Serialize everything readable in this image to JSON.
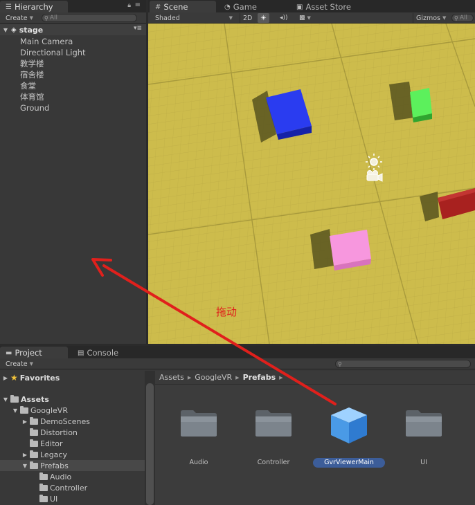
{
  "hierarchy": {
    "tab_label": "Hierarchy",
    "create_label": "Create",
    "search_placeholder": "All",
    "root_label": "stage",
    "items": [
      {
        "label": "Main Camera"
      },
      {
        "label": "Directional Light"
      },
      {
        "label": "教学楼"
      },
      {
        "label": "宿舍楼"
      },
      {
        "label": "食堂"
      },
      {
        "label": "体育馆"
      },
      {
        "label": "Ground"
      }
    ]
  },
  "scene": {
    "tabs": [
      {
        "label": "Scene",
        "icon": "grid-icon"
      },
      {
        "label": "Game",
        "icon": "pacman-icon"
      },
      {
        "label": "Asset Store",
        "icon": "bag-icon"
      }
    ],
    "shading_mode": "Shaded",
    "mode_2d_label": "2D",
    "gizmos_label": "Gizmos",
    "search_placeholder": "All",
    "ground_color": "#cdbc4c",
    "objects": [
      {
        "name": "blue-cube",
        "color": "#1f2fe0"
      },
      {
        "name": "green-cube",
        "color": "#3fd23f"
      },
      {
        "name": "red-block",
        "color": "#a4201f"
      },
      {
        "name": "pink-block",
        "color": "#f58fd6"
      }
    ]
  },
  "project": {
    "tabs": [
      {
        "label": "Project",
        "icon": "folder-icon"
      },
      {
        "label": "Console",
        "icon": "console-icon"
      }
    ],
    "create_label": "Create",
    "tree": [
      {
        "label": "Favorites",
        "level": 0,
        "bold": true,
        "expanded": false
      },
      {
        "label": "Assets",
        "level": 0,
        "bold": true,
        "expanded": true
      },
      {
        "label": "GoogleVR",
        "level": 1,
        "bold": false,
        "expanded": true
      },
      {
        "label": "DemoScenes",
        "level": 2,
        "bold": false,
        "expanded": false
      },
      {
        "label": "Distortion",
        "level": 2,
        "bold": false,
        "expanded": null
      },
      {
        "label": "Editor",
        "level": 2,
        "bold": false,
        "expanded": null
      },
      {
        "label": "Legacy",
        "level": 2,
        "bold": false,
        "expanded": false
      },
      {
        "label": "Prefabs",
        "level": 2,
        "bold": false,
        "expanded": true
      },
      {
        "label": "Audio",
        "level": 3,
        "bold": false,
        "expanded": null
      },
      {
        "label": "Controller",
        "level": 3,
        "bold": false,
        "expanded": null
      },
      {
        "label": "UI",
        "level": 3,
        "bold": false,
        "expanded": null
      }
    ],
    "breadcrumb": [
      "Assets",
      "GoogleVR",
      "Prefabs"
    ],
    "assets": [
      {
        "label": "Audio",
        "kind": "folder"
      },
      {
        "label": "Controller",
        "kind": "folder"
      },
      {
        "label": "GvrViewerMain",
        "kind": "prefab"
      },
      {
        "label": "UI",
        "kind": "folder"
      }
    ],
    "selected_color": "#3c5d99"
  },
  "annotation": {
    "text": "拖动",
    "color": "#e0201c"
  }
}
